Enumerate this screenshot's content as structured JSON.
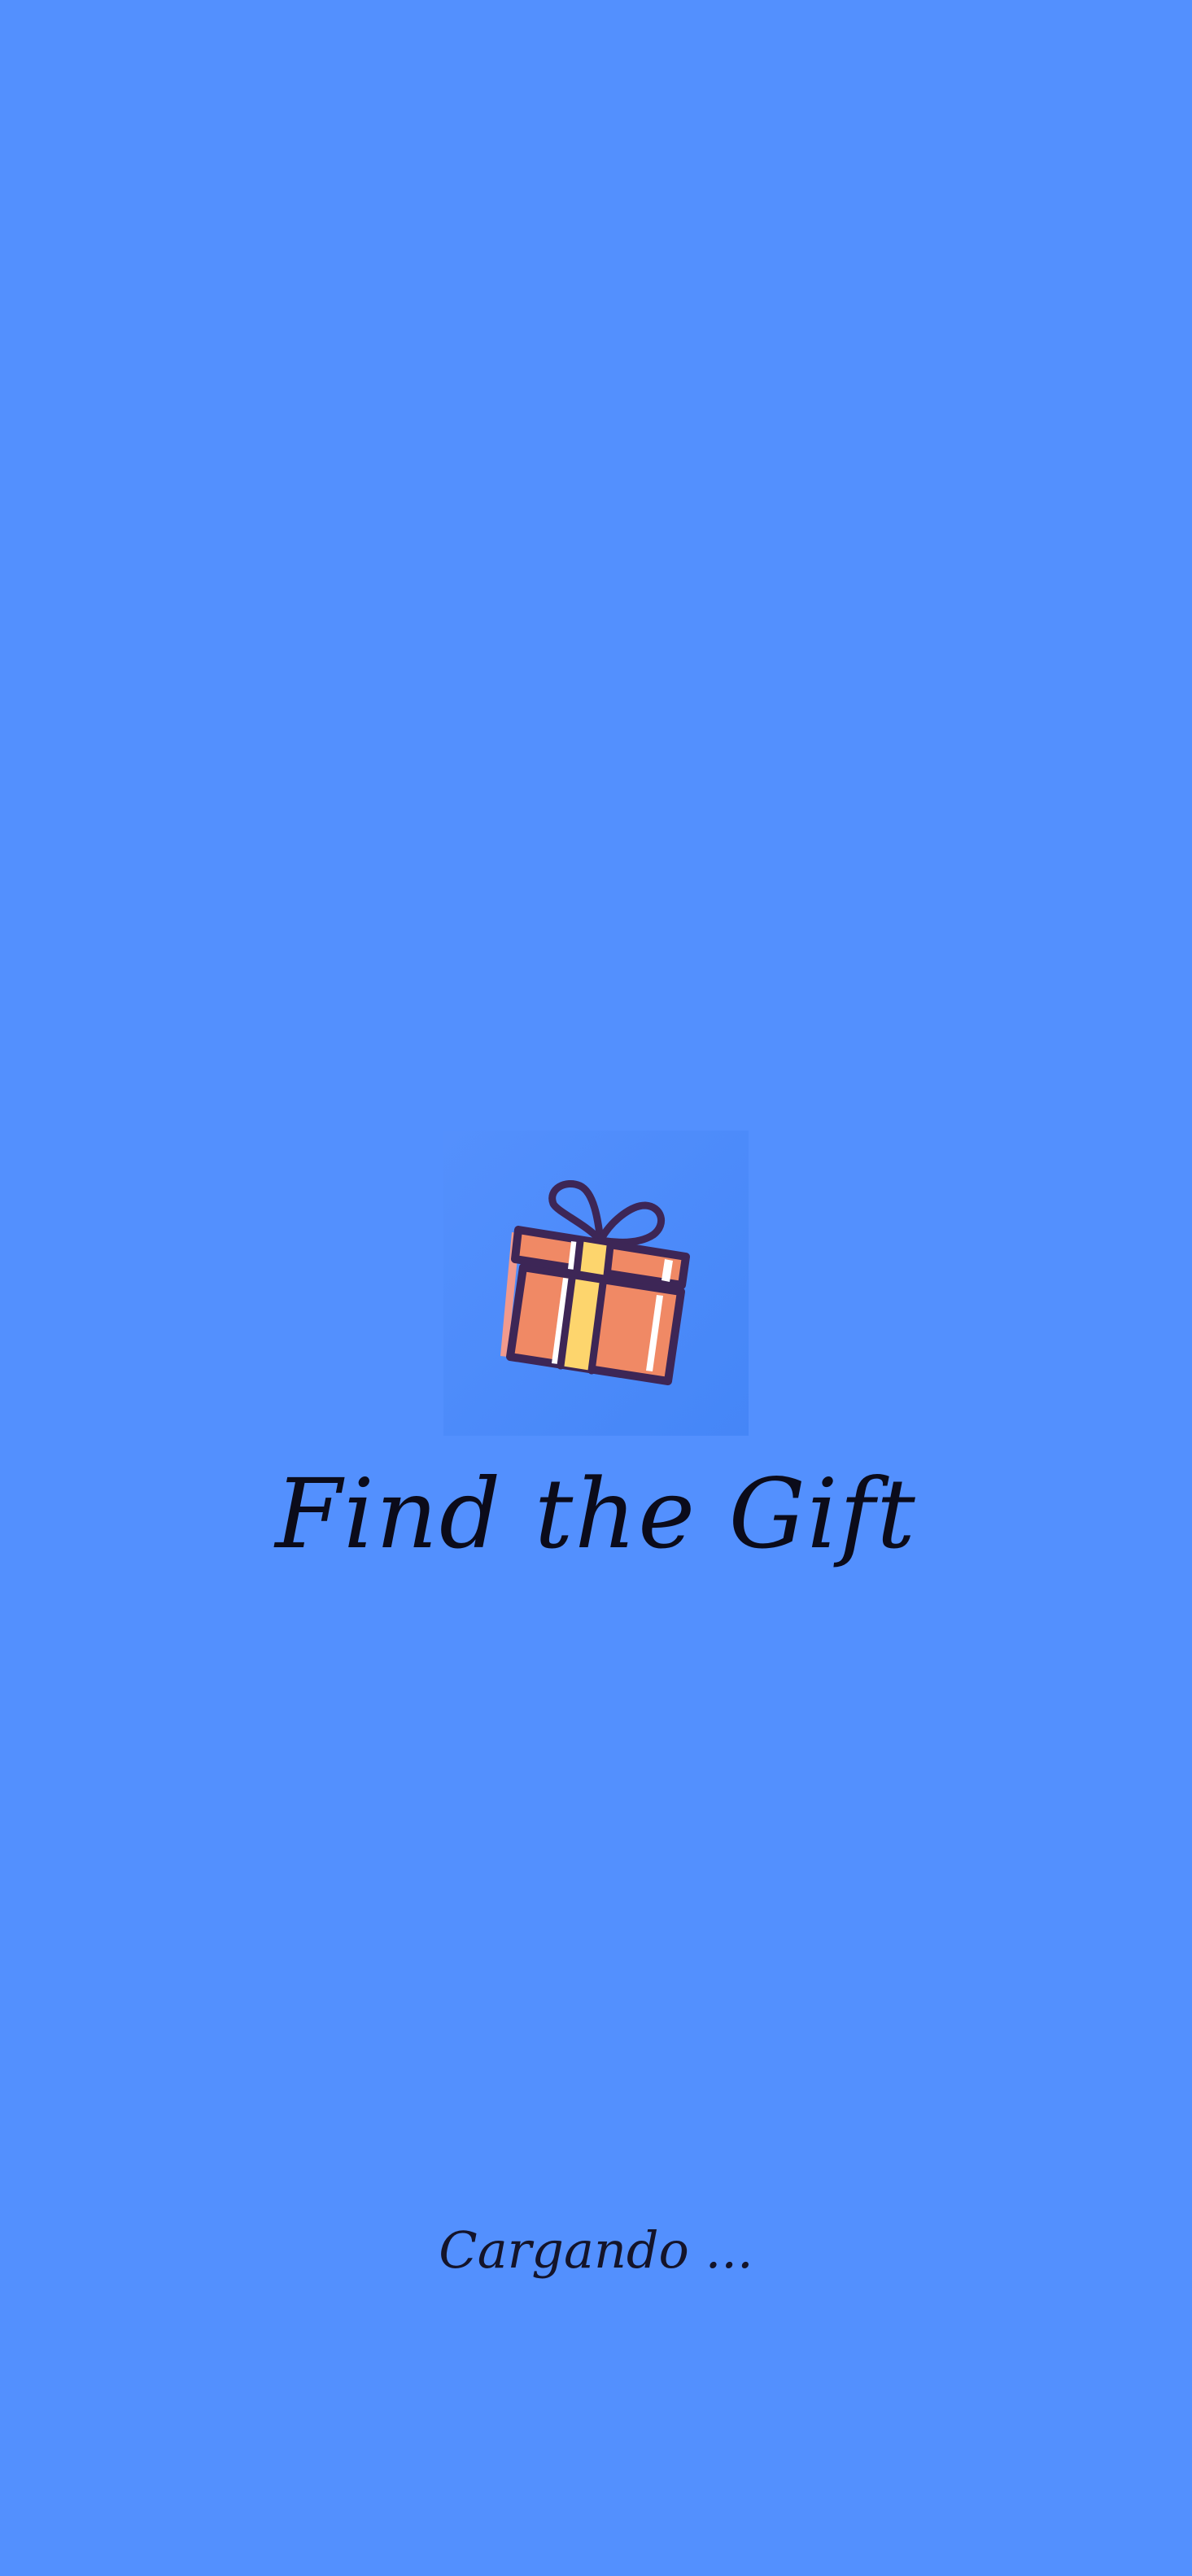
{
  "splash": {
    "background_color": "#5390fe",
    "logo_icon": "gift-box-icon",
    "title": "Find the Gift",
    "loading_text": "Cargando ..."
  }
}
